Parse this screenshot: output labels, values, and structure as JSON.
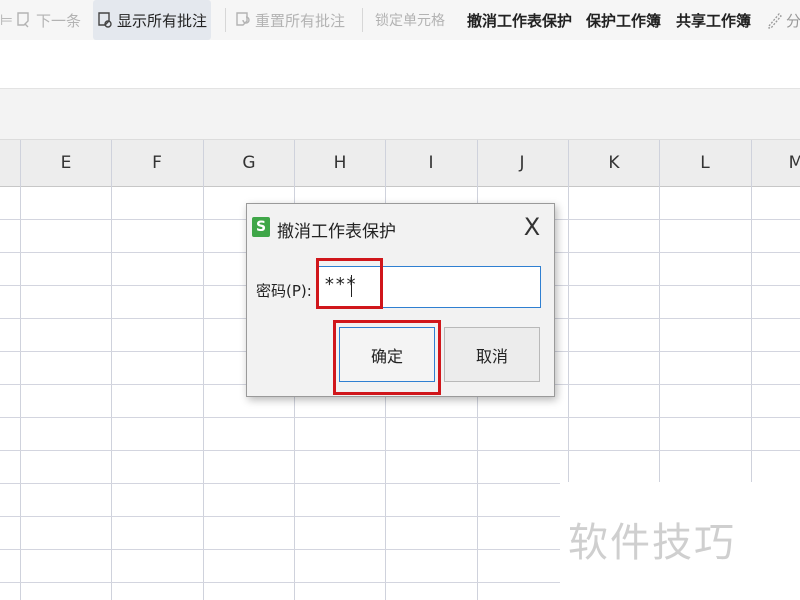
{
  "ribbon": {
    "items": [
      {
        "label": "下一条",
        "state": "disabled",
        "icon": "next-comment-icon"
      },
      {
        "label": "显示所有批注",
        "state": "active",
        "icon": "show-comments-icon"
      },
      {
        "label": "重置所有批注",
        "state": "disabled",
        "icon": "reset-comments-icon"
      },
      {
        "label": "锁定单元格",
        "state": "disabled"
      },
      {
        "label": "撤消工作表保护",
        "state": "enabled"
      },
      {
        "label": "保护工作簿",
        "state": "enabled"
      },
      {
        "label": "共享工作簿",
        "state": "enabled"
      },
      {
        "label": "分",
        "state": "enabled",
        "icon": "edit-area-icon"
      }
    ]
  },
  "sheet": {
    "columns": [
      "E",
      "F",
      "G",
      "H",
      "I",
      "J",
      "K",
      "L",
      "M"
    ]
  },
  "dialog": {
    "app_icon_letter": "S",
    "title": "撤消工作表保护",
    "close_label": "X",
    "password_label": "密码(P):",
    "password_value": "***",
    "ok_label": "确定",
    "cancel_label": "取消"
  },
  "watermark": "软件技巧",
  "colors": {
    "highlight_red": "#d0161b",
    "focus_blue": "#2f7fd1",
    "app_icon_green": "#3fa648"
  }
}
